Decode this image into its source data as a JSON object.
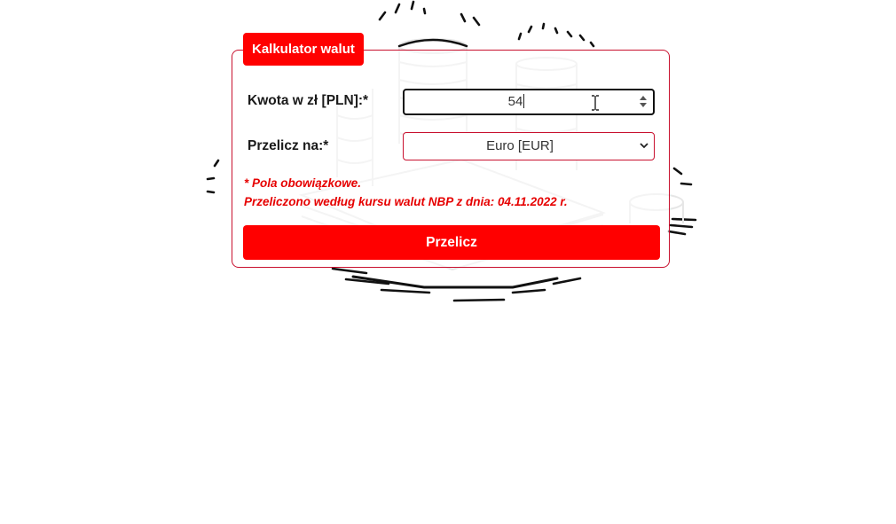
{
  "calculator": {
    "title": "Kalkulator walut",
    "amount_label": "Kwota w zł [PLN]:*",
    "amount_value": "54",
    "currency_label": "Przelicz na:*",
    "currency_selected": "Euro [EUR]",
    "required_note": "* Pola obowiązkowe.",
    "rate_note": "Przeliczono według kursu walut NBP z dnia: 04.11.2022 r.",
    "convert_label": "Przelicz"
  },
  "colors": {
    "accent": "#ff0000",
    "border": "#c8102e",
    "note_text": "#e60000"
  },
  "icons": {
    "background": "coins-banknotes-sketch-illustration",
    "spinner": "number-spinner-icon",
    "dropdown": "chevron-down-icon",
    "cursor": "text-cursor-icon"
  }
}
